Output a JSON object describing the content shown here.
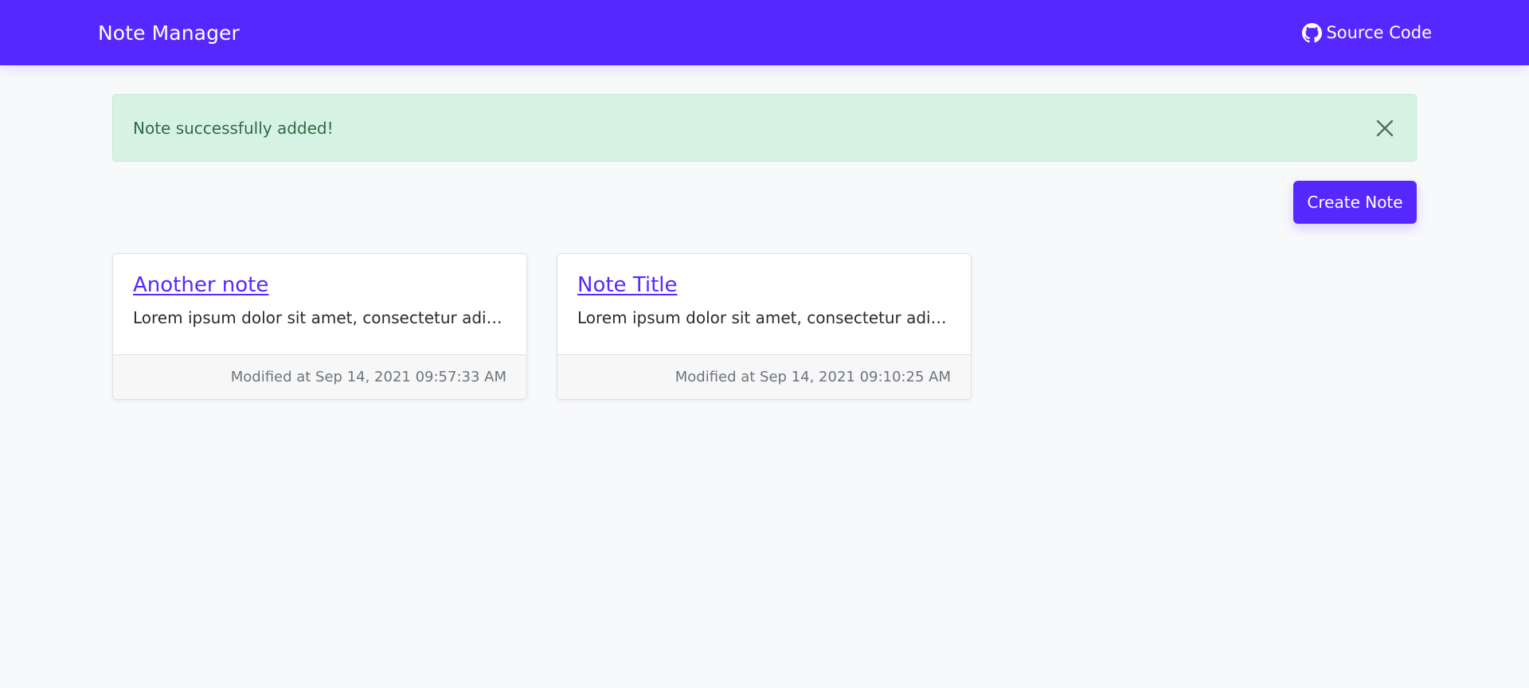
{
  "colors": {
    "brand": "#5628ff",
    "alert_bg": "#d6f2e3",
    "alert_text": "#2f6b45",
    "page_bg": "#f8f9fb"
  },
  "navbar": {
    "brand": "Note Manager",
    "source_label": "Source Code",
    "source_icon": "github-icon"
  },
  "alert": {
    "message": "Note successfully added!",
    "close_icon": "close-icon"
  },
  "toolbar": {
    "create_label": "Create Note"
  },
  "notes": [
    {
      "title": "Another note",
      "excerpt": "Lorem ipsum dolor sit amet, consectetur adipiscing elit",
      "modified": "Modified at Sep 14, 2021 09:57:33 AM"
    },
    {
      "title": "Note Title",
      "excerpt": "Lorem ipsum dolor sit amet, consectetur adipiscing elit",
      "modified": "Modified at Sep 14, 2021 09:10:25 AM"
    }
  ]
}
